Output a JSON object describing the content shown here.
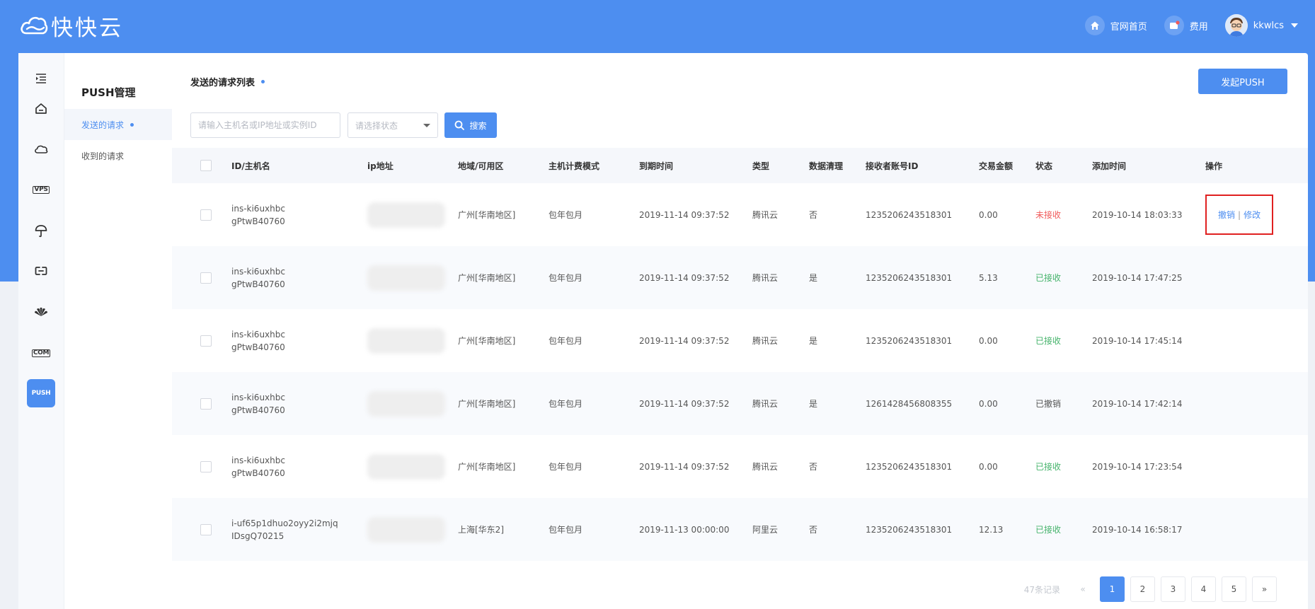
{
  "brand": {
    "name": "快快云"
  },
  "topnav": {
    "home_label": "官网首页",
    "fee_label": "费用",
    "username": "kkwlcs"
  },
  "sidebar": {
    "icons": [
      "menu-toggle-icon",
      "home-icon",
      "cloud-icon",
      "vps-icon",
      "umbrella-icon",
      "link-icon",
      "huawei-icon",
      "com-icon",
      "push-icon"
    ],
    "vps_text": "VPS",
    "com_text": "COM",
    "push_text": "PUSH"
  },
  "submenu": {
    "title": "PUSH管理",
    "items": [
      {
        "label": "发送的请求",
        "active": true
      },
      {
        "label": "收到的请求",
        "active": false
      }
    ]
  },
  "main": {
    "title": "发送的请求列表",
    "create_button": "发起PUSH",
    "search_placeholder": "请输入主机名或IP地址或实例ID",
    "status_placeholder": "请选择状态",
    "search_button": "搜索"
  },
  "table": {
    "headers": [
      "ID/主机名",
      "ip地址",
      "地域/可用区",
      "主机计费模式",
      "到期时间",
      "类型",
      "数据清理",
      "接收者账号ID",
      "交易金额",
      "状态",
      "添加时间",
      "操作"
    ],
    "rows": [
      {
        "id": "ins-ki6uxhbc",
        "host": "gPtwB40760",
        "region": "广州[华南地区]",
        "billing": "包年包月",
        "expire": "2019-11-14 09:37:52",
        "type": "腾讯云",
        "clean": "否",
        "receiver": "1235206243518301",
        "amount": "0.00",
        "status": "未接收",
        "added": "2019-10-14 18:03:33",
        "op_cancel": "撤销",
        "op_sep": "|",
        "op_edit": "修改"
      },
      {
        "id": "ins-ki6uxhbc",
        "host": "gPtwB40760",
        "region": "广州[华南地区]",
        "billing": "包年包月",
        "expire": "2019-11-14 09:37:52",
        "type": "腾讯云",
        "clean": "是",
        "receiver": "1235206243518301",
        "amount": "5.13",
        "status": "已接收",
        "added": "2019-10-14 17:47:25"
      },
      {
        "id": "ins-ki6uxhbc",
        "host": "gPtwB40760",
        "region": "广州[华南地区]",
        "billing": "包年包月",
        "expire": "2019-11-14 09:37:52",
        "type": "腾讯云",
        "clean": "是",
        "receiver": "1235206243518301",
        "amount": "0.00",
        "status": "已接收",
        "added": "2019-10-14 17:45:14"
      },
      {
        "id": "ins-ki6uxhbc",
        "host": "gPtwB40760",
        "region": "广州[华南地区]",
        "billing": "包年包月",
        "expire": "2019-11-14 09:37:52",
        "type": "腾讯云",
        "clean": "是",
        "receiver": "1261428456808355",
        "amount": "0.00",
        "status": "已撤销",
        "added": "2019-10-14 17:42:14"
      },
      {
        "id": "ins-ki6uxhbc",
        "host": "gPtwB40760",
        "region": "广州[华南地区]",
        "billing": "包年包月",
        "expire": "2019-11-14 09:37:52",
        "type": "腾讯云",
        "clean": "否",
        "receiver": "1235206243518301",
        "amount": "0.00",
        "status": "已接收",
        "added": "2019-10-14 17:23:54"
      },
      {
        "id": "i-uf65p1dhuo2oyy2i2mjq",
        "host": "IDsgQ70215",
        "region": "上海[华东2]",
        "billing": "包年包月",
        "expire": "2019-11-13 00:00:00",
        "type": "阿里云",
        "clean": "否",
        "receiver": "1235206243518301",
        "amount": "12.13",
        "status": "已接收",
        "added": "2019-10-14 16:58:17"
      }
    ]
  },
  "pagination": {
    "total_text": "47条记录",
    "prev": "«",
    "next": "»",
    "pages": [
      "1",
      "2",
      "3",
      "4",
      "5"
    ],
    "current": "1"
  },
  "colors": {
    "primary": "#4d8ef0",
    "status_unreceived": "#f05b5b",
    "status_received": "#45b36b",
    "highlight_box": "#e02020"
  }
}
